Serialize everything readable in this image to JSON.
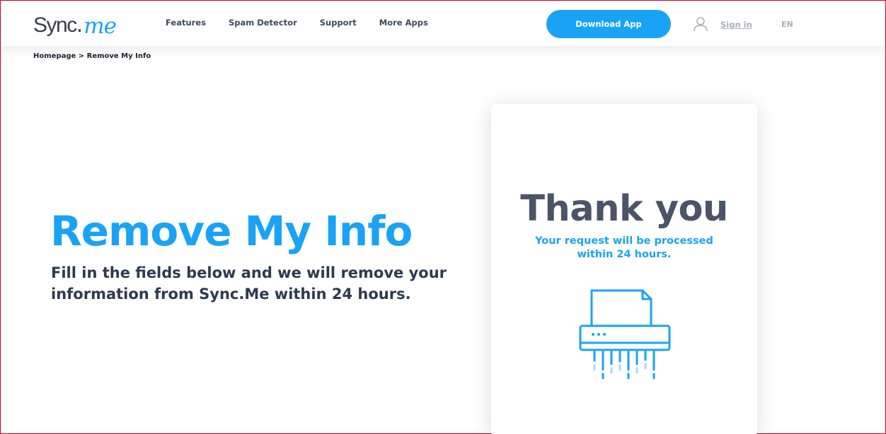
{
  "header": {
    "logo": {
      "part1": "Sync",
      "part2": ".",
      "part3": "me"
    },
    "nav": [
      "Features",
      "Spam Detector",
      "Support",
      "More Apps"
    ],
    "download_label": "Download App",
    "signin_label": "Sign in",
    "lang_label": "EN"
  },
  "breadcrumb": "Homepage > Remove My Info",
  "hero": {
    "title": "Remove My Info",
    "subtitle": "Fill in the fields below and we will remove your information from Sync.Me within 24 hours."
  },
  "card": {
    "title": "Thank you",
    "message": "Your request will be processed within 24 hours."
  },
  "icons": {
    "user": "user-icon",
    "shredder": "paper-shredder-icon"
  },
  "colors": {
    "brand_blue": "#1aa3f4",
    "dark_text": "#2e3a4f",
    "card_title": "#4b5468",
    "muted": "#a7aeb8"
  }
}
